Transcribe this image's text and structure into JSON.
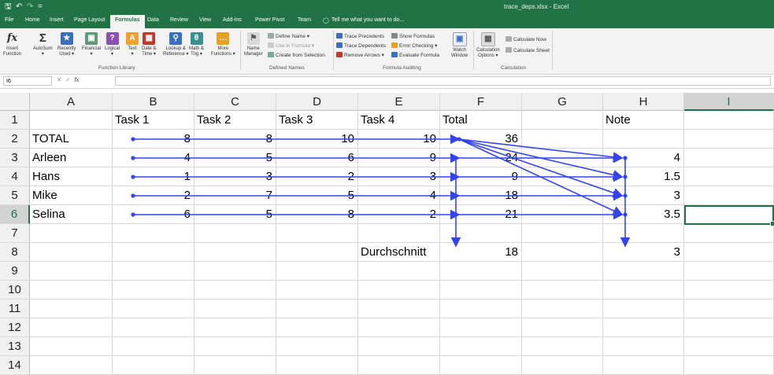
{
  "window": {
    "title": "trace_deps.xlsx - Excel",
    "save_glyph": "🖫",
    "undo_glyph": "↶",
    "redo_glyph": "↷",
    "customize_glyph": "="
  },
  "tabs": [
    "File",
    "Home",
    "Insert",
    "Page Layout",
    "Formulas",
    "Data",
    "Review",
    "View",
    "Add-ins",
    "Power Pivot",
    "Team"
  ],
  "active_tab": "Formulas",
  "tell_me": "Tell me what you want to do...",
  "ribbon": {
    "function_library": {
      "label": "Function Library",
      "insert_function": [
        "Insert",
        "Function"
      ],
      "autosum": [
        "AutoSum",
        "▾"
      ],
      "recently_used": [
        "Recently",
        "Used ▾"
      ],
      "financial": [
        "Financial",
        "▾"
      ],
      "logical": [
        "Logical",
        "▾"
      ],
      "text": [
        "Text",
        "▾"
      ],
      "date_time": [
        "Date &",
        "Time ▾"
      ],
      "lookup_reference": [
        "Lookup &",
        "Reference ▾"
      ],
      "math_trig": [
        "Math &",
        "Trig ▾"
      ],
      "more_functions": [
        "More",
        "Functions ▾"
      ]
    },
    "defined_names": {
      "label": "Defined Names",
      "name_manager": [
        "Name",
        "Manager"
      ],
      "define_name": "Define Name ▾",
      "use_in_formula": "Use in Formula ▾",
      "create_from_selection": "Create from Selection"
    },
    "formula_auditing": {
      "label": "Formula Auditing",
      "trace_precedents": "Trace Precedents",
      "trace_dependents": "Trace Dependents",
      "remove_arrows": "Remove Arrows ▾",
      "show_formulas": "Show Formulas",
      "error_checking": "Error Checking ▾",
      "evaluate_formula": "Evaluate Formula",
      "watch_window": [
        "Watch",
        "Window"
      ]
    },
    "calculation": {
      "label": "Calculation",
      "calc_options": [
        "Calculation",
        "Options ▾"
      ],
      "calculate_now": "Calculate Now",
      "calculate_sheet": "Calculate Sheet"
    }
  },
  "formula_bar": {
    "name_box": "I6",
    "cancel": "✕",
    "enter": "✓",
    "fx": "fx",
    "value": ""
  },
  "columns": [
    "A",
    "B",
    "C",
    "D",
    "E",
    "F",
    "G",
    "H",
    "I"
  ],
  "rows": [
    "1",
    "2",
    "3",
    "4",
    "5",
    "6",
    "7",
    "8",
    "9",
    "10",
    "11",
    "12",
    "13",
    "14"
  ],
  "selected_cell": "I6",
  "cells": {
    "header": {
      "B": "Task 1",
      "C": "Task 2",
      "D": "Task 3",
      "E": "Task 4",
      "F": "Total",
      "H": "Note"
    },
    "row_labels": [
      "TOTAL",
      "Arleen",
      "Hans",
      "Mike",
      "Selina"
    ],
    "task_values": [
      [
        "8",
        "8",
        "10",
        "10"
      ],
      [
        "4",
        "5",
        "6",
        "9"
      ],
      [
        "1",
        "3",
        "2",
        "3"
      ],
      [
        "2",
        "7",
        "5",
        "4"
      ],
      [
        "6",
        "5",
        "8",
        "2"
      ]
    ],
    "totals": [
      "36",
      "24",
      "9",
      "18",
      "21"
    ],
    "notes": [
      "4",
      "1.5",
      "3",
      "3.5"
    ],
    "average_label": "Durchschnitt",
    "average_total": "18",
    "average_note": "3"
  },
  "colors": {
    "excel_green": "#217346",
    "tracer_blue": "#3344ee",
    "ribbon_bg": "#f3f3f3"
  }
}
